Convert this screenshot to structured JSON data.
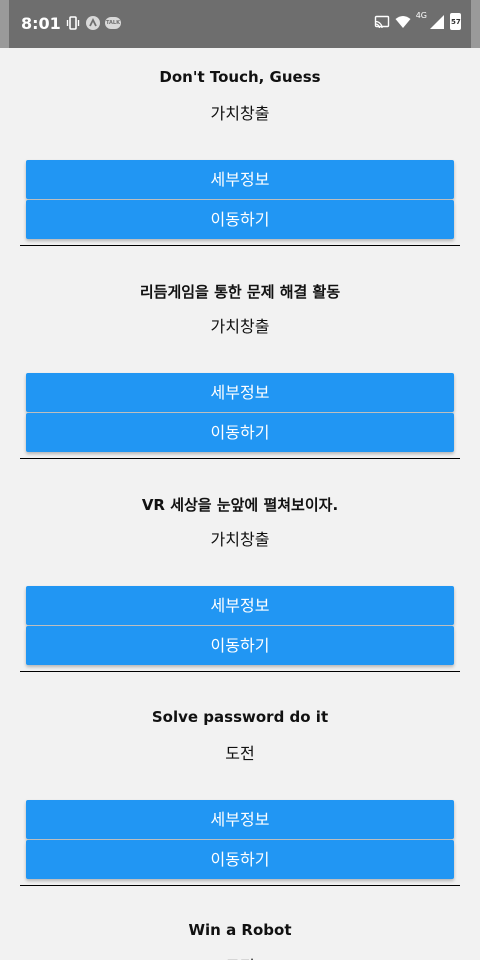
{
  "status_bar": {
    "time": "8:01",
    "network": "4G",
    "battery": "57"
  },
  "items": [
    {
      "title": "Don't Touch, Guess",
      "category": "가치창출",
      "detail_label": "세부정보",
      "go_label": "이동하기"
    },
    {
      "title": "리듬게임을 통한 문제 해결 활동",
      "category": "가치창출",
      "detail_label": "세부정보",
      "go_label": "이동하기"
    },
    {
      "title": "VR 세상을 눈앞에 펼쳐보이자.",
      "category": "가치창출",
      "detail_label": "세부정보",
      "go_label": "이동하기"
    },
    {
      "title": "Solve password do it",
      "category": "도전",
      "detail_label": "세부정보",
      "go_label": "이동하기"
    },
    {
      "title": "Win a Robot",
      "category": "도전"
    }
  ],
  "colors": {
    "button": "#2196f3",
    "status_bar": "#6e6e6e",
    "background": "#f2f2f2"
  }
}
